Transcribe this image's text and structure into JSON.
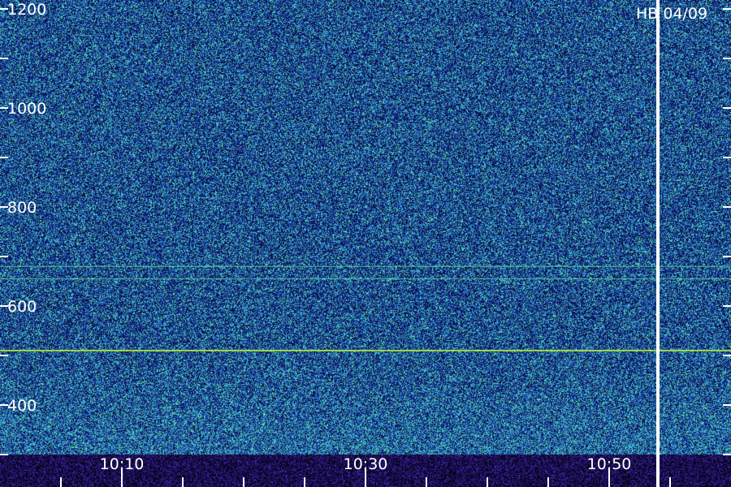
{
  "chart_data": {
    "type": "heatmap",
    "title": "",
    "station_label": "HB 04/09",
    "xlabel": "",
    "ylabel": "",
    "y_ticks": [
      {
        "value": 400,
        "label": "400"
      },
      {
        "value": 600,
        "label": "600"
      },
      {
        "value": 800,
        "label": "800"
      },
      {
        "value": 1000,
        "label": "1000"
      },
      {
        "value": 1200,
        "label": "1200"
      }
    ],
    "y_minor_ticks": [
      300,
      500,
      700,
      900,
      1100
    ],
    "x_ticks": [
      {
        "value": "10:10",
        "label": "10:10"
      },
      {
        "value": "10:30",
        "label": "10:30"
      },
      {
        "value": "10:50",
        "label": "10:50"
      }
    ],
    "x_minor_ticks": [
      "10:05",
      "10:15",
      "10:20",
      "10:25",
      "10:35",
      "10:40",
      "10:45",
      "10:55"
    ],
    "marker_line": {
      "time": "10:54"
    },
    "horizontal_bands": [
      {
        "frequency": 510,
        "strength": "strong"
      },
      {
        "frequency": 655,
        "strength": "weak"
      },
      {
        "frequency": 680,
        "strength": "weak"
      }
    ],
    "colors": {
      "background": "#0a0e4a",
      "low": "#1d3fa6",
      "mid": "#2b9bd6",
      "high": "#5fe0a0",
      "peak": "#b8f040",
      "labels": "#ffffff",
      "marker": "#ffffff"
    }
  }
}
